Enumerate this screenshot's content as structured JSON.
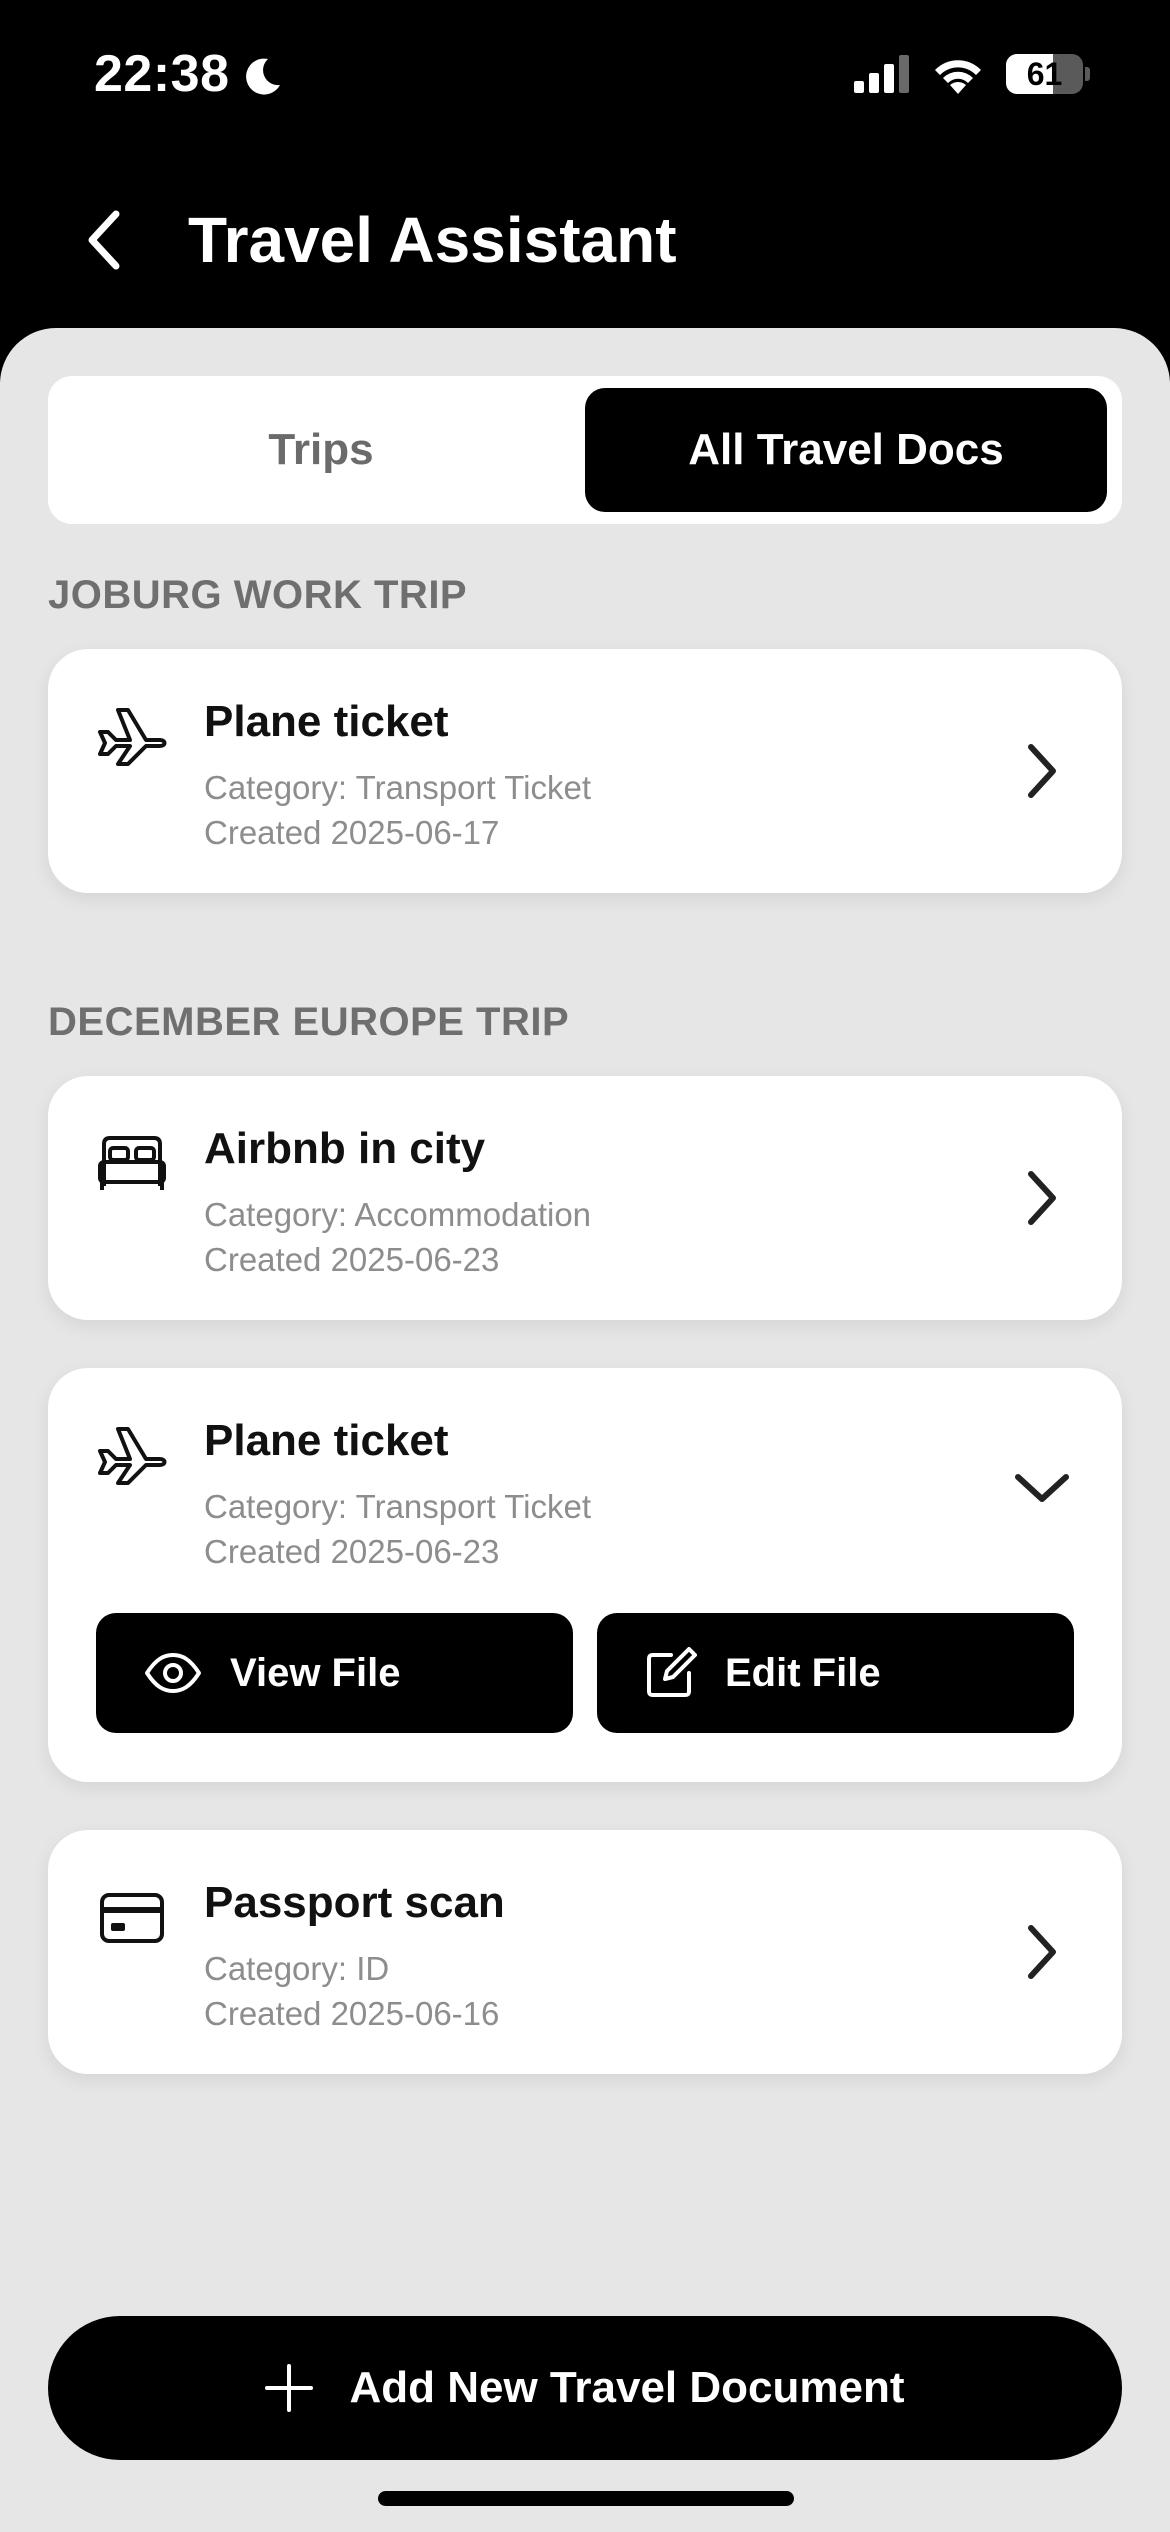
{
  "status_bar": {
    "time": "22:38",
    "battery_level": "61",
    "battery_fraction": 0.61
  },
  "header": {
    "title": "Travel Assistant"
  },
  "tabs": [
    {
      "label": "Trips",
      "selected": false
    },
    {
      "label": "All Travel Docs",
      "selected": true
    }
  ],
  "sections": [
    {
      "title": "JOBURG WORK TRIP",
      "documents": [
        {
          "icon": "plane-icon",
          "title": "Plane ticket",
          "category": "Category: Transport Ticket",
          "created": "Created 2025-06-17",
          "expanded": false
        }
      ]
    },
    {
      "title": "DECEMBER EUROPE TRIP",
      "documents": [
        {
          "icon": "bed-icon",
          "title": "Airbnb in city",
          "category": "Category: Accommodation",
          "created": "Created 2025-06-23",
          "expanded": false
        },
        {
          "icon": "plane-icon",
          "title": "Plane ticket",
          "category": "Category: Transport Ticket",
          "created": "Created 2025-06-23",
          "expanded": true,
          "actions": [
            {
              "icon": "eye-icon",
              "label": "View File"
            },
            {
              "icon": "edit-icon",
              "label": "Edit File"
            }
          ]
        },
        {
          "icon": "id-card-icon",
          "title": "Passport scan",
          "category": "Category: ID",
          "created": "Created 2025-06-16",
          "expanded": false
        }
      ]
    }
  ],
  "add_button": {
    "icon": "plus-icon",
    "label": "Add New Travel Document"
  }
}
